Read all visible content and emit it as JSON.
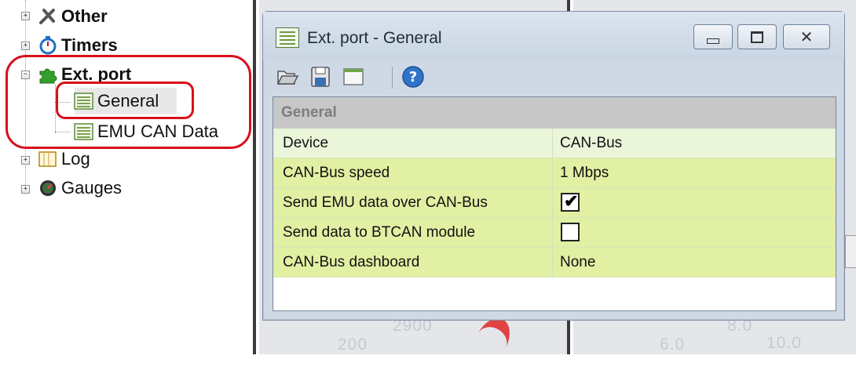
{
  "tree": {
    "items": [
      {
        "label": "Other",
        "icon": "tools-icon"
      },
      {
        "label": "Timers",
        "icon": "stopwatch-icon"
      },
      {
        "label": "Ext. port",
        "icon": "puzzle-icon"
      },
      {
        "label": "General",
        "icon": "table-icon"
      },
      {
        "label": "EMU CAN Data",
        "icon": "table-icon"
      },
      {
        "label": "Log",
        "icon": "chart-icon"
      },
      {
        "label": "Gauges",
        "icon": "gauge-icon"
      }
    ],
    "selected": "General",
    "annotation_color": "#d7101a"
  },
  "window": {
    "title": "Ext. port - General",
    "controls": [
      "minimize-icon",
      "maximize-icon",
      "close-icon"
    ],
    "toolbar": [
      "open-folder-icon",
      "save-icon",
      "window-icon",
      "help-icon"
    ]
  },
  "grid": {
    "header": "General",
    "rows": [
      {
        "name": "Device",
        "value": "CAN-Bus",
        "kind": "text"
      },
      {
        "name": "CAN-Bus speed",
        "value": "1 Mbps",
        "kind": "text"
      },
      {
        "name": "Send EMU data over CAN-Bus",
        "checked": true,
        "kind": "checkbox"
      },
      {
        "name": "Send data to BTCAN module",
        "checked": false,
        "kind": "checkbox"
      },
      {
        "name": "CAN-Bus dashboard",
        "value": "None",
        "kind": "text"
      }
    ],
    "row_colors": {
      "first": "#eaf5d9",
      "rest": "#e1f0a3"
    }
  },
  "background": {
    "gauge_left_labels": [
      "200",
      "2900"
    ],
    "gauge_right_labels": [
      "6.0",
      "10.0",
      "8.0"
    ]
  }
}
